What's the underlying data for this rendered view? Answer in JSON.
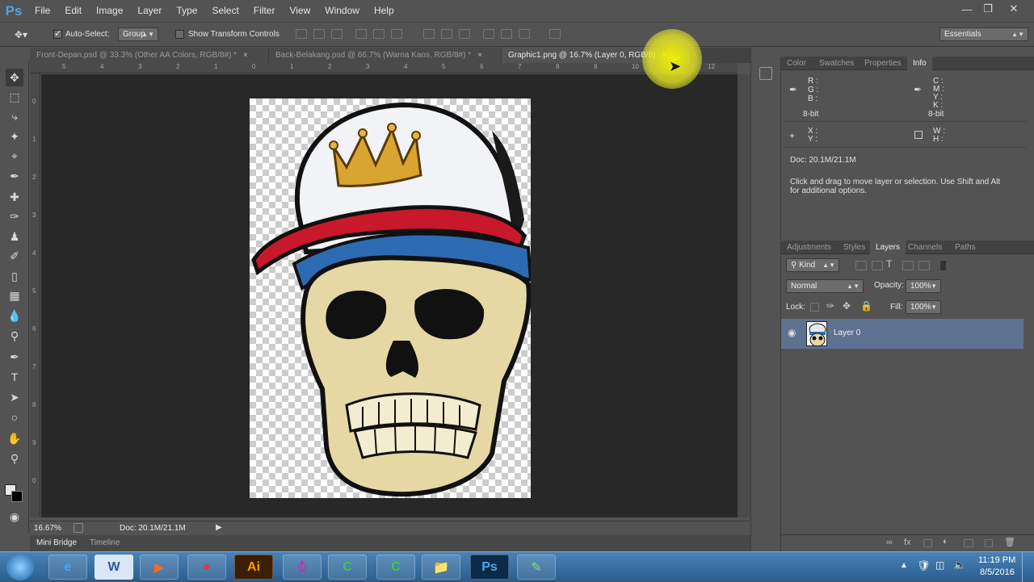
{
  "app": {
    "logo": "Ps"
  },
  "menu": [
    "File",
    "Edit",
    "Image",
    "Layer",
    "Type",
    "Select",
    "Filter",
    "View",
    "Window",
    "Help"
  ],
  "options": {
    "auto_select_label": "Auto-Select:",
    "auto_select_checked": true,
    "auto_select_mode": "Group",
    "show_transform_label": "Show Transform Controls",
    "show_transform_checked": false,
    "workspace": "Essentials"
  },
  "tabs": [
    {
      "label": "Front-Depan.psd @ 33.3% (Other AA Colors, RGB/8#) *",
      "active": false
    },
    {
      "label": "Back-Belakang.psd @ 66.7% (Warna Kaos, RGB/8#) *",
      "active": false
    },
    {
      "label": "Graphic1.png @ 16.7% (Layer 0, RGB/8)",
      "active": true
    }
  ],
  "ruler": {
    "h_ticks": [
      "5",
      "4",
      "3",
      "2",
      "1",
      "0",
      "1",
      "2",
      "3",
      "4",
      "5",
      "6",
      "7",
      "8",
      "9",
      "10",
      "11",
      "12"
    ],
    "v_ticks": [
      "0",
      "1",
      "2",
      "3",
      "4",
      "5",
      "6",
      "7",
      "8",
      "9",
      "0"
    ]
  },
  "status": {
    "zoom": "16.67%",
    "doc": "Doc: 20.1M/21.1M"
  },
  "bottom_tabs": [
    "Mini Bridge",
    "Timeline"
  ],
  "info_panel": {
    "tabs": [
      "Color",
      "Swatches",
      "Properties",
      "Info"
    ],
    "active_tab": "Info",
    "rgb": [
      "R :",
      "G :",
      "B :"
    ],
    "cmyk": [
      "C :",
      "M :",
      "Y :",
      "K :"
    ],
    "bitdepth_left": "8-bit",
    "bitdepth_right": "8-bit",
    "xy": [
      "X :",
      "Y :"
    ],
    "wh": [
      "W :",
      "H :"
    ],
    "doc": "Doc: 20.1M/21.1M",
    "hint": "Click and drag to move layer or selection.  Use Shift and Alt for additional options."
  },
  "layers_panel": {
    "tabs": [
      "Adjustments",
      "Styles",
      "Layers",
      "Channels",
      "Paths"
    ],
    "active_tab": "Layers",
    "filter": "Kind",
    "blend_mode": "Normal",
    "opacity_label": "Opacity:",
    "opacity": "100%",
    "lock_label": "Lock:",
    "fill_label": "Fill:",
    "fill": "100%",
    "layers": [
      {
        "name": "Layer 0",
        "visible": true,
        "selected": true
      }
    ]
  },
  "taskbar": {
    "apps": [
      "start",
      "ie-icon",
      "word-icon",
      "media-player-icon",
      "chrome-icon",
      "illustrator-icon",
      "spiral-app-icon",
      "coreldraw-icon",
      "coreldraw-2-icon",
      "file-explorer-icon",
      "photoshop-icon",
      "green-app-icon"
    ],
    "illustrator_label": "Ai",
    "photoshop_label": "Ps",
    "time": "11:19 PM",
    "date": "8/5/2016"
  },
  "colors": {
    "panel": "#535353",
    "canvas": "#282828",
    "selected_layer": "#5f7190",
    "ps_blue": "#4fa3e8"
  }
}
